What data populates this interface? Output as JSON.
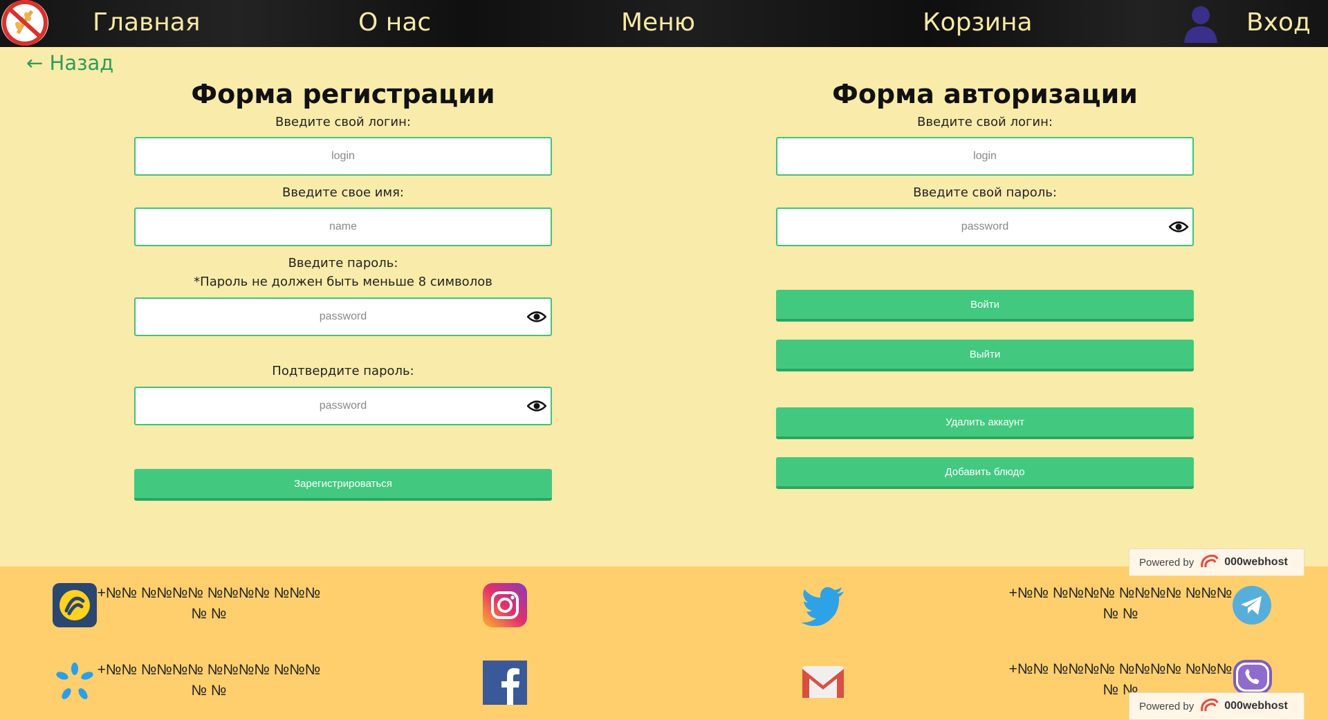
{
  "nav": {
    "home": "Главная",
    "about": "О нас",
    "menu": "Меню",
    "cart": "Корзина",
    "login": "Вход"
  },
  "back_link": "← Назад",
  "registration": {
    "title": "Форма регистрации",
    "login_label": "Введите свой логин:",
    "login_placeholder": "login",
    "name_label": "Введите свое имя:",
    "name_placeholder": "name",
    "password_label": "Введите пароль:",
    "password_hint": "*Пароль не должен быть меньше 8 символов",
    "password_placeholder": "password",
    "confirm_label": "Подтвердите пароль:",
    "confirm_placeholder": "password",
    "submit_label": "Зарегистрироваться"
  },
  "authorization": {
    "title": "Форма авторизации",
    "login_label": "Введите свой логин:",
    "login_placeholder": "login",
    "password_label": "Введите свой пароль:",
    "password_placeholder": "password",
    "login_button": "Войти",
    "logout_button": "Выйти",
    "delete_button": "Удалить аккаунт",
    "add_dish_button": "Добавить блюдо"
  },
  "footer": {
    "phone_lifecell": "+№№ №№№№ №№№№ №№№№ №",
    "phone_kyivstar": "+№№ №№№№ №№№№ №№№№ №",
    "phone_telegram": "+№№ №№№№ №№№№ №№№№ №",
    "phone_viber": "+№№ №№№№ №№№№ №№№№ №",
    "powered_prefix": "Powered by",
    "powered_brand": "000webhost"
  },
  "colors": {
    "accent": "#42c97f",
    "background": "#f9eba9",
    "footer": "#fecf6c",
    "nav_text": "#f7e9a4"
  }
}
